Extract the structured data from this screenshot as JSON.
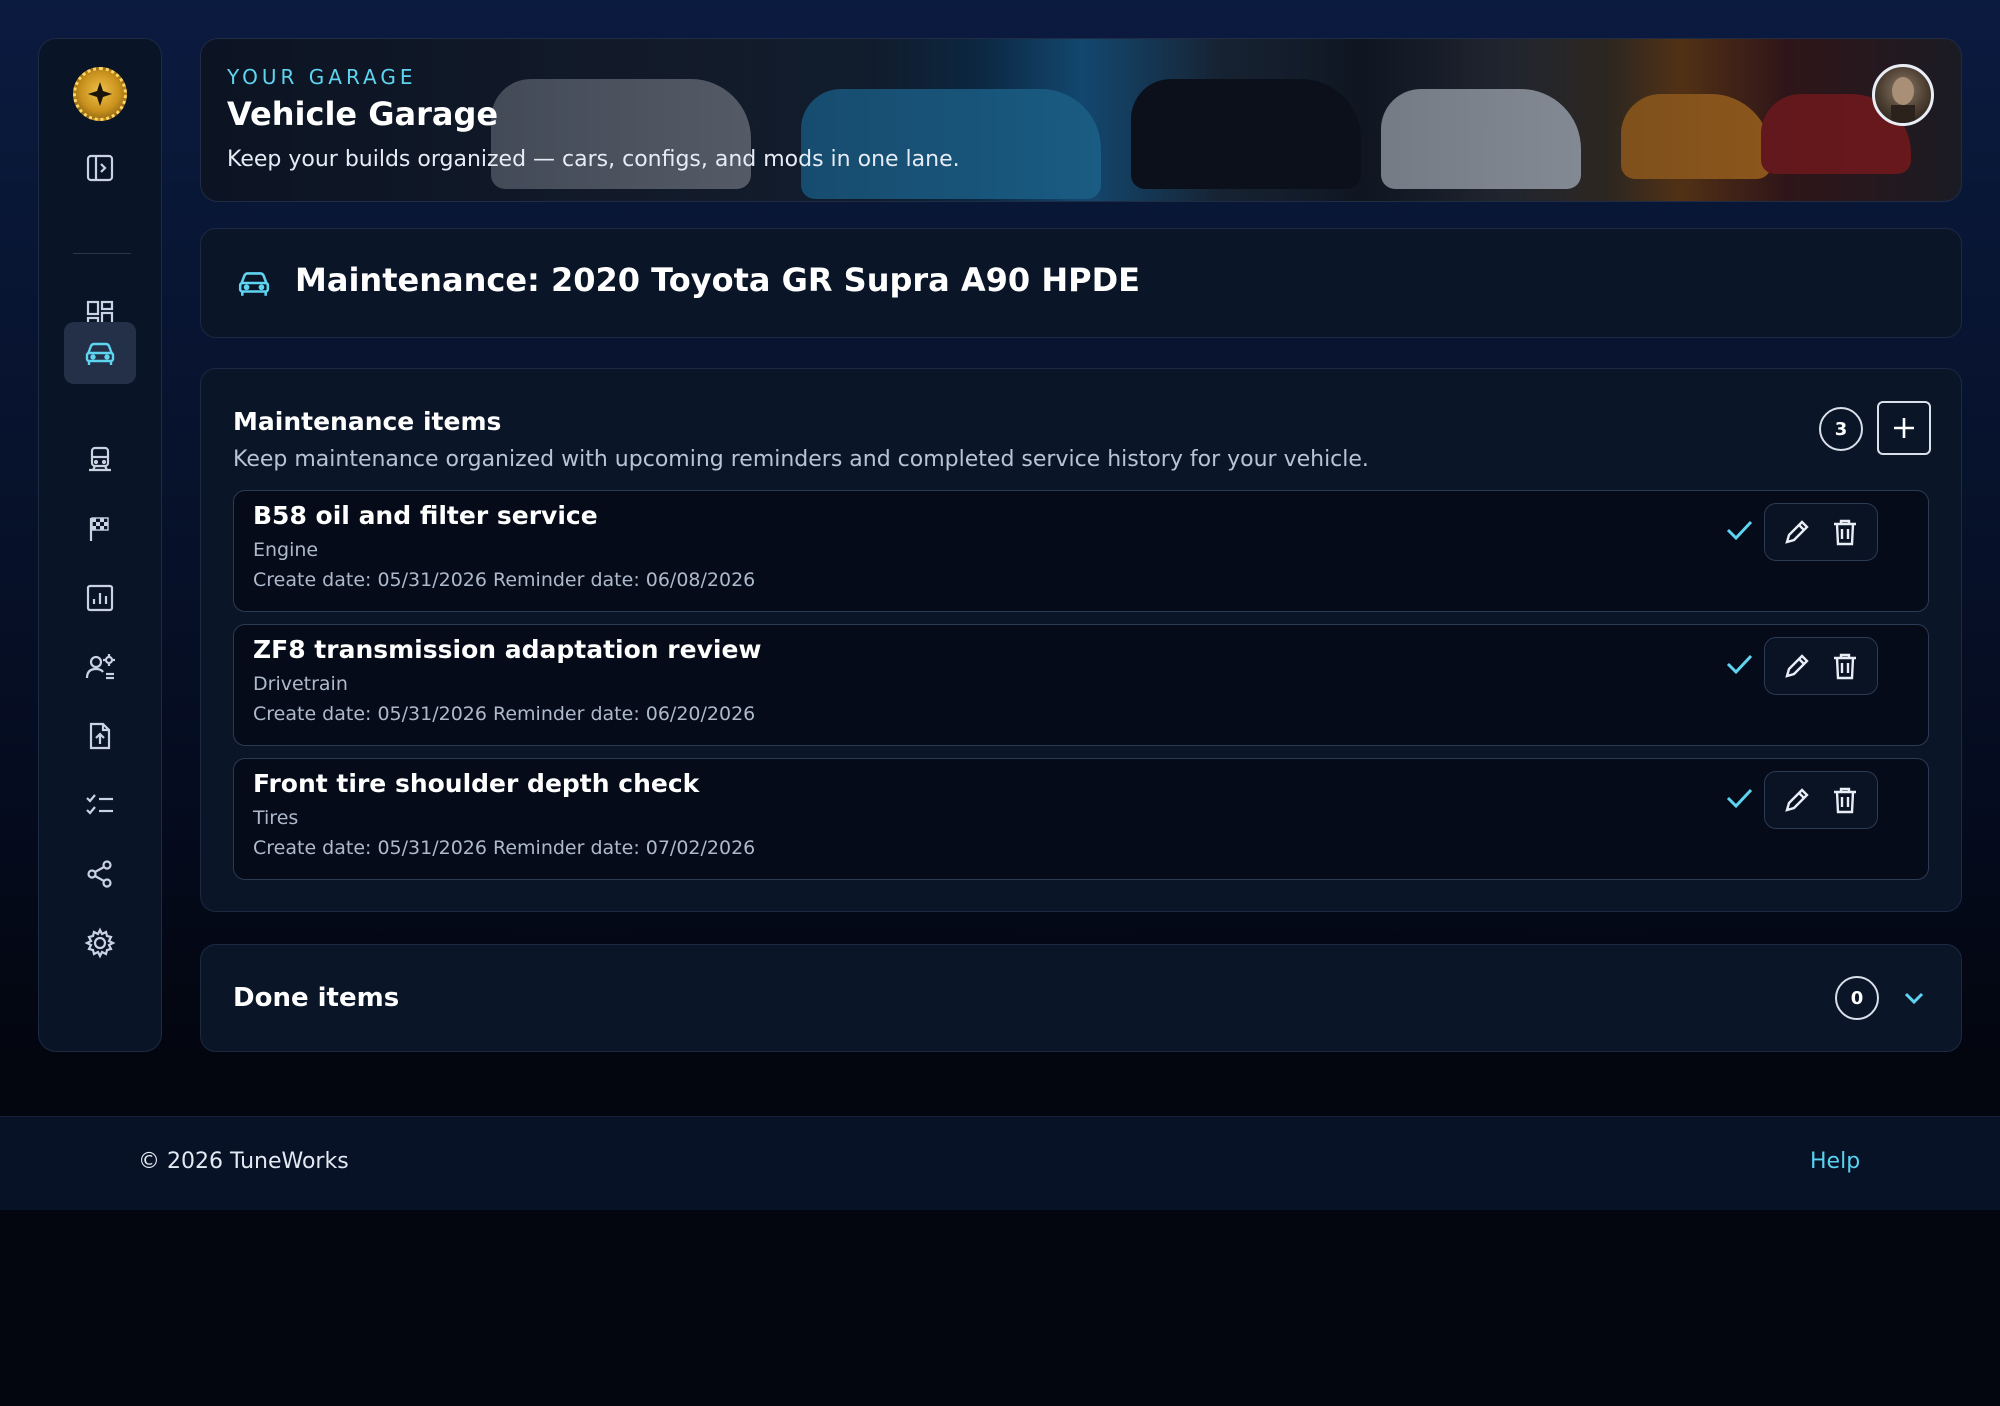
{
  "banner": {
    "eyebrow": "YOUR GARAGE",
    "title": "Vehicle Garage",
    "subtitle": "Keep your builds organized — cars, configs, and mods in one lane."
  },
  "sidebar": {
    "items": [
      {
        "icon": "dashboard-icon",
        "active": false
      },
      {
        "icon": "car-icon",
        "active": true
      },
      {
        "icon": "train-icon",
        "active": false
      },
      {
        "icon": "race-flag-icon",
        "active": false
      },
      {
        "icon": "analytics-icon",
        "active": false
      },
      {
        "icon": "user-settings-icon",
        "active": false
      },
      {
        "icon": "file-upload-icon",
        "active": false
      },
      {
        "icon": "checklist-icon",
        "active": false
      },
      {
        "icon": "share-icon",
        "active": false
      },
      {
        "icon": "gear-icon",
        "active": false
      }
    ]
  },
  "page": {
    "title": "Maintenance: 2020 Toyota GR Supra A90 HPDE"
  },
  "maintenance": {
    "heading": "Maintenance items",
    "description": "Keep maintenance organized with upcoming reminders and completed service history for your vehicle.",
    "count": "3",
    "items": [
      {
        "name": "B58 oil and filter service",
        "category": "Engine",
        "dates": "Create date: 05/31/2026 Reminder date: 06/08/2026"
      },
      {
        "name": "ZF8 transmission adaptation review",
        "category": "Drivetrain",
        "dates": "Create date: 05/31/2026 Reminder date: 06/20/2026"
      },
      {
        "name": "Front tire shoulder depth check",
        "category": "Tires",
        "dates": "Create date: 05/31/2026 Reminder date: 07/02/2026"
      }
    ]
  },
  "done": {
    "heading": "Done items",
    "count": "0"
  },
  "footer": {
    "copyright": "© 2026 TuneWorks",
    "help": "Help"
  },
  "colors": {
    "accent": "#5fd4f0",
    "background": "#03060f",
    "card": "#0b1528"
  }
}
